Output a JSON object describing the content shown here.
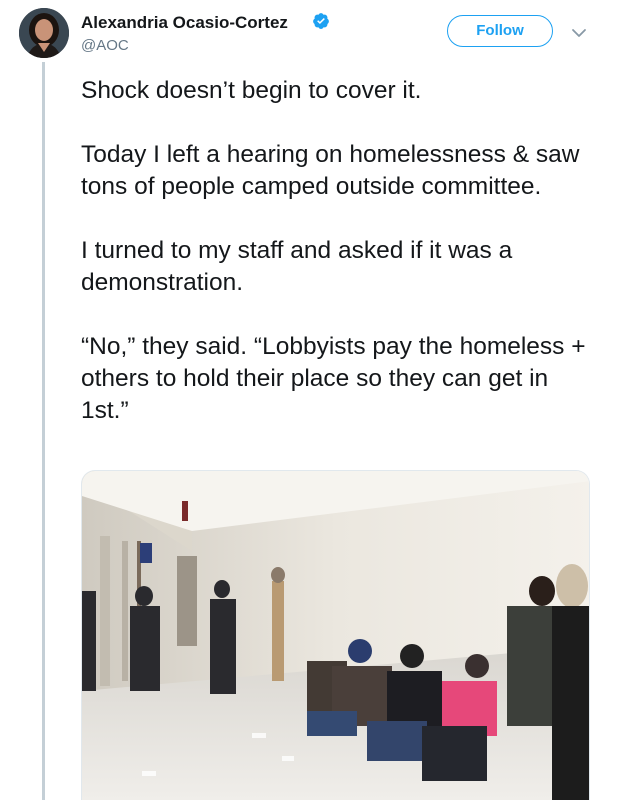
{
  "tweet": {
    "author_name": "Alexandria Ocasio-Cortez",
    "author_handle": "@AOC",
    "verified": true,
    "follow_label": "Follow",
    "paragraphs": [
      "Shock doesn’t begin to cover it.",
      "Today I left a hearing on homelessness & saw tons of people camped outside committee.",
      "I turned to my staff and asked if it was a demonstration.",
      "“No,” they said. “Lobbyists pay the homeless + others to hold their place so they can get in 1st.”"
    ],
    "photo": {
      "icon": "photo-icon"
    }
  },
  "colors": {
    "accent": "#1da1f2",
    "text": "#14171a",
    "secondary_text": "#657786",
    "thread_line": "#c4cfd6"
  }
}
